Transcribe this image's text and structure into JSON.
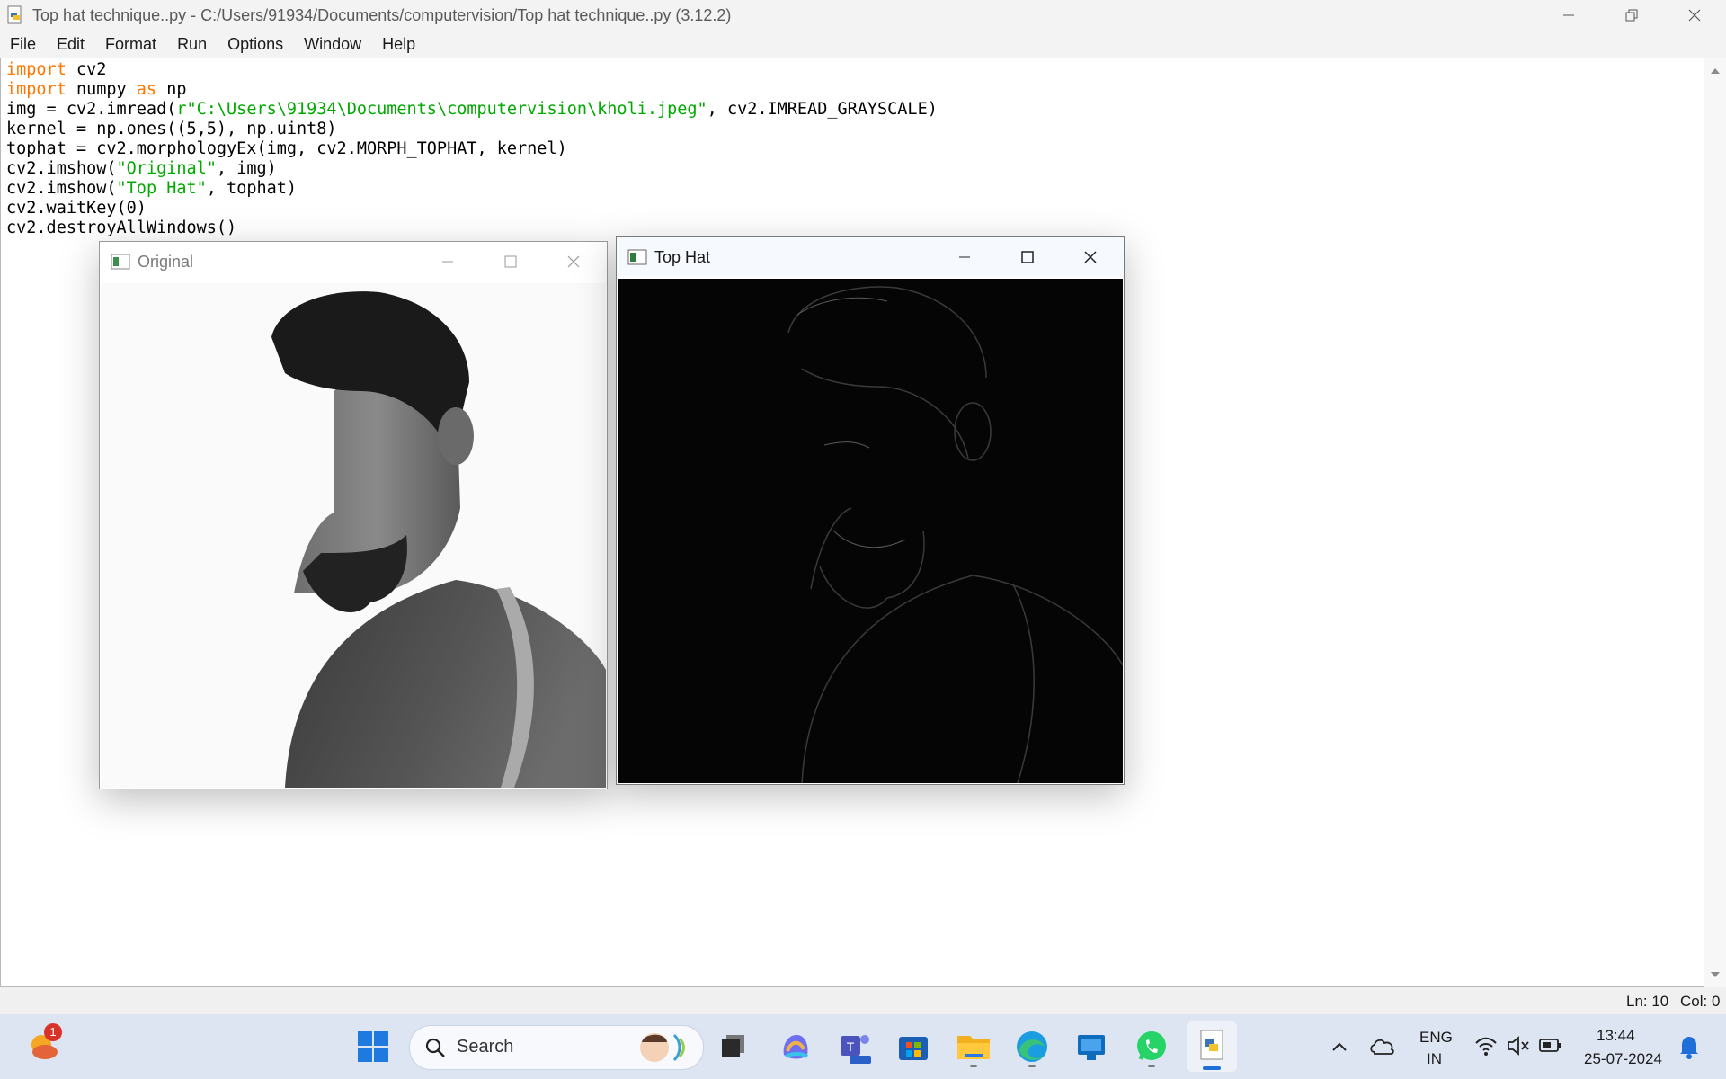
{
  "window": {
    "title": "Top hat technique..py - C:/Users/91934/Documents/computervision/Top hat technique..py (3.12.2)"
  },
  "menu": [
    "File",
    "Edit",
    "Format",
    "Run",
    "Options",
    "Window",
    "Help"
  ],
  "code_lines": [
    [
      {
        "t": "import",
        "c": "kw"
      },
      {
        "t": " cv2",
        "c": ""
      }
    ],
    [
      {
        "t": "import",
        "c": "kw"
      },
      {
        "t": " numpy ",
        "c": ""
      },
      {
        "t": "as",
        "c": "kw"
      },
      {
        "t": " np",
        "c": ""
      }
    ],
    [
      {
        "t": "img = cv2.imread(",
        "c": ""
      },
      {
        "t": "r\"C:\\Users\\91934\\Documents\\computervision\\kholi.jpeg\"",
        "c": "st"
      },
      {
        "t": ", cv2.IMREAD_GRAYSCALE)",
        "c": ""
      }
    ],
    [
      {
        "t": "kernel = np.ones((5,5), np.uint8)",
        "c": ""
      }
    ],
    [
      {
        "t": "tophat = cv2.morphologyEx(img, cv2.MORPH_TOPHAT, kernel)",
        "c": ""
      }
    ],
    [
      {
        "t": "cv2.imshow(",
        "c": ""
      },
      {
        "t": "\"Original\"",
        "c": "st"
      },
      {
        "t": ", img)",
        "c": ""
      }
    ],
    [
      {
        "t": "cv2.imshow(",
        "c": ""
      },
      {
        "t": "\"Top Hat\"",
        "c": "st"
      },
      {
        "t": ", tophat)",
        "c": ""
      }
    ],
    [
      {
        "t": "cv2.waitKey(0)",
        "c": ""
      }
    ],
    [
      {
        "t": "cv2.destroyAllWindows()",
        "c": ""
      }
    ]
  ],
  "status": {
    "line": "Ln: 10",
    "col": "Col: 0"
  },
  "cv_windows": {
    "original": {
      "title": "Original"
    },
    "tophat": {
      "title": "Top Hat"
    }
  },
  "taskbar": {
    "search_placeholder": "Search",
    "weather_badge": "1",
    "language": "ENG",
    "region": "IN",
    "time": "13:44",
    "date": "25-07-2024"
  },
  "icons": [
    "python-file-icon",
    "minimize-icon",
    "restore-icon",
    "close-icon",
    "maximize-icon",
    "windows-start-icon",
    "search-icon",
    "task-view-icon",
    "copilot-icon",
    "teams-icon",
    "store-icon",
    "file-explorer-icon",
    "edge-icon",
    "app-icon",
    "whatsapp-icon",
    "idle-python-icon",
    "chevron-up-icon",
    "onedrive-icon",
    "wifi-icon",
    "speaker-muted-icon",
    "battery-icon",
    "notification-bell-icon"
  ],
  "colors": {
    "keyword": "#ff7700",
    "string": "#00aa00",
    "taskbar": "#dde5f3"
  }
}
